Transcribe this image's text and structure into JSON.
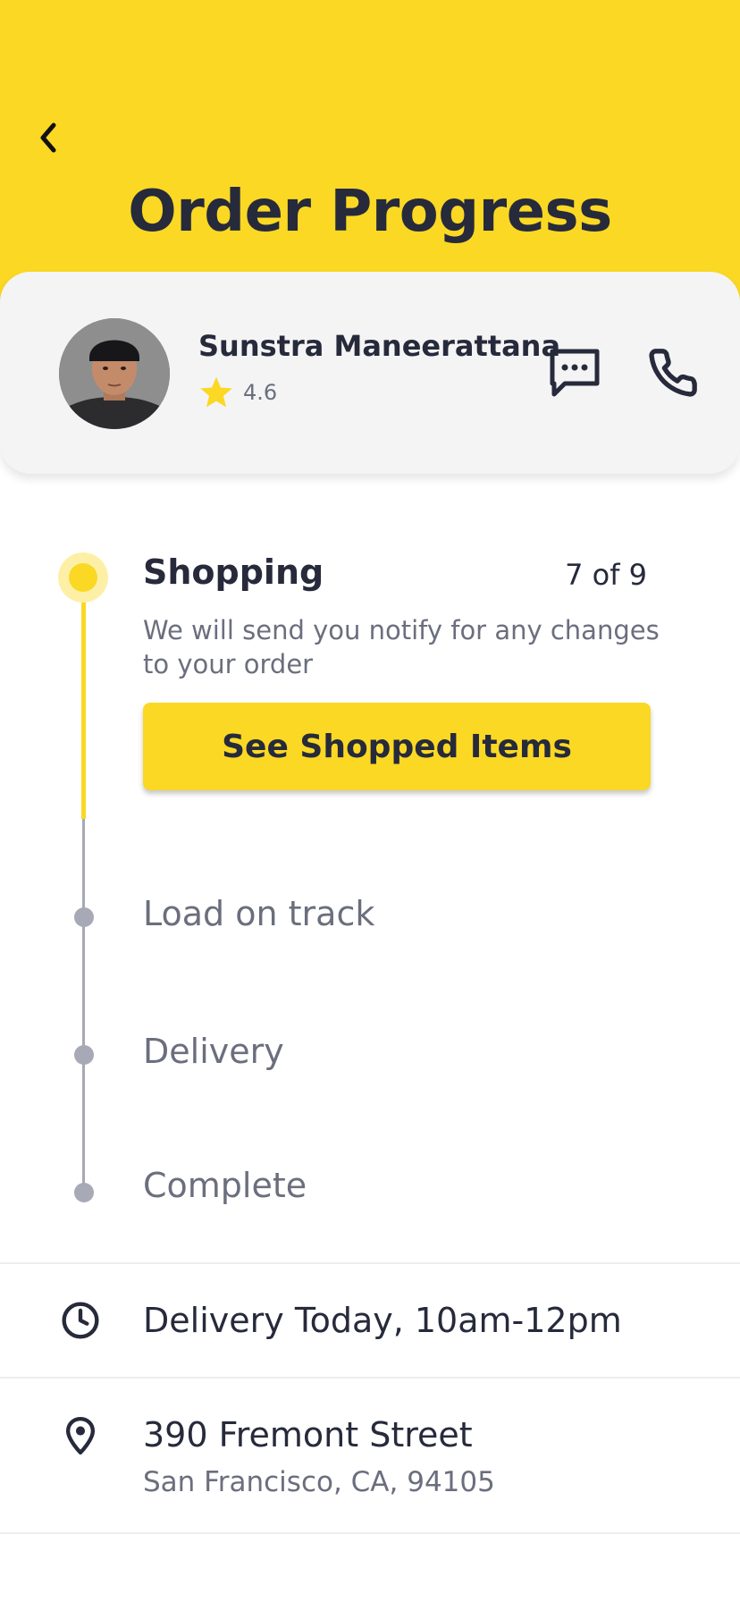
{
  "header": {
    "title": "Order Progress",
    "back_icon": "chevron-left-icon",
    "background_color": "#fad824"
  },
  "shopper": {
    "name": "Sunstra Maneerattana",
    "rating": "4.6",
    "rating_icon": "star-icon",
    "chat_icon": "message-icon",
    "call_icon": "phone-icon"
  },
  "progress": {
    "active_step": {
      "title": "Shopping",
      "count": "7 of 9",
      "description": "We will send you notify for any changes to your order",
      "button_label": "See Shopped Items"
    },
    "upcoming_steps": [
      {
        "title": "Load on track"
      },
      {
        "title": "Delivery"
      },
      {
        "title": "Complete"
      }
    ],
    "active_color": "#fad824",
    "inactive_color": "#a7a9b7"
  },
  "delivery": {
    "time": "Delivery Today, 10am-12pm",
    "time_icon": "clock-icon",
    "address_line1": "390 Fremont Street",
    "address_line2": "San Francisco, CA, 94105",
    "address_icon": "map-pin-icon"
  }
}
